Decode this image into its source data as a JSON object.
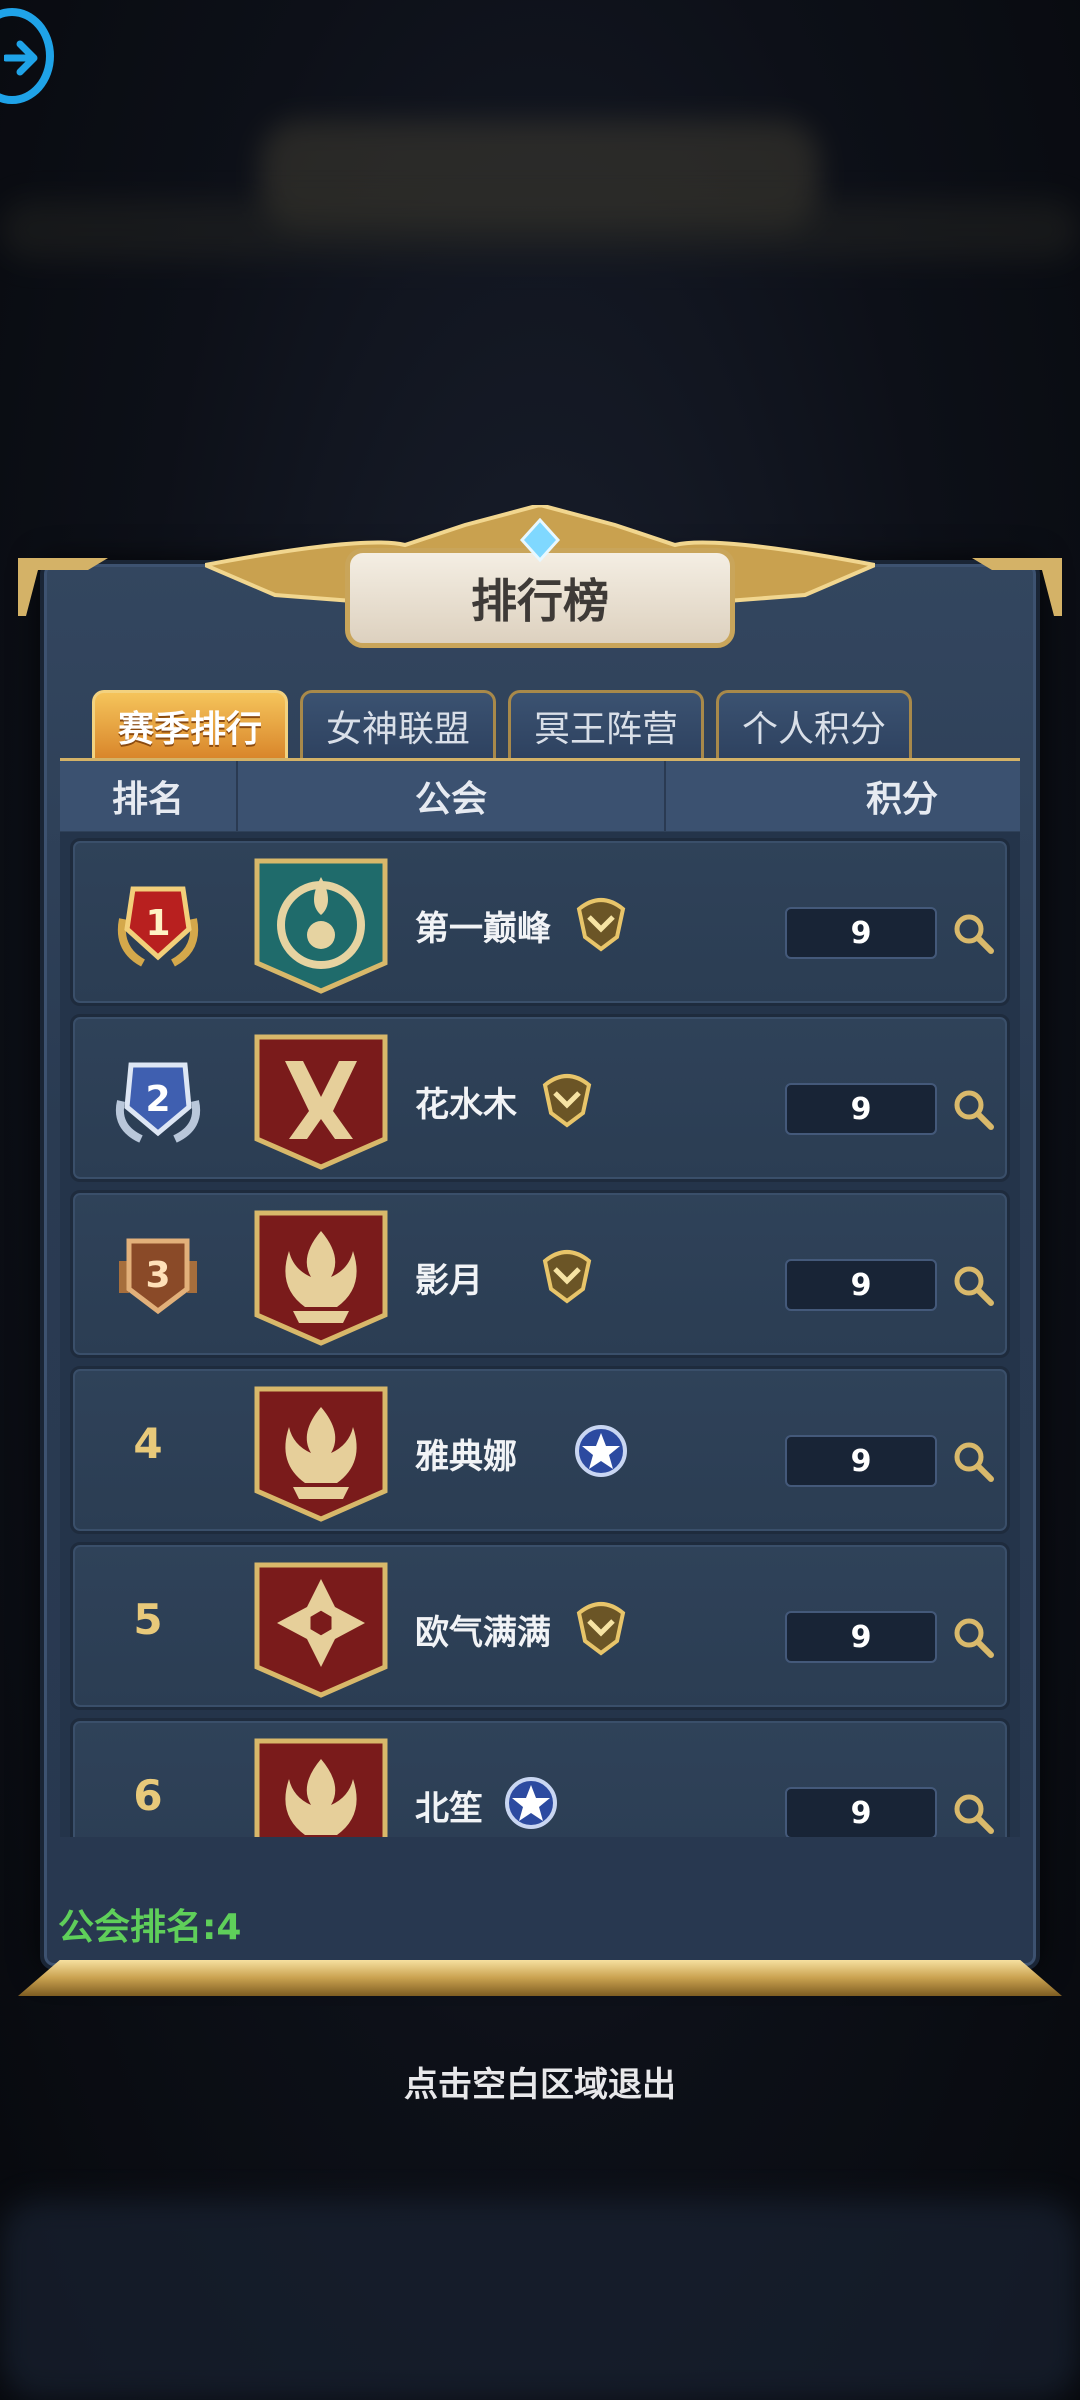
{
  "title": "排行榜",
  "tabs": [
    {
      "label": "赛季排行",
      "active": true
    },
    {
      "label": "女神联盟",
      "active": false
    },
    {
      "label": "冥王阵营",
      "active": false
    },
    {
      "label": "个人积分",
      "active": false
    }
  ],
  "columns": {
    "rank": "排名",
    "guild": "公会",
    "score": "积分"
  },
  "rows": [
    {
      "rank": "1",
      "name": "第一巅峰",
      "score": "9",
      "emblem": "teal-flame-crest",
      "badge": "gold-wing-badge"
    },
    {
      "rank": "2",
      "name": "花水木",
      "score": "9",
      "emblem": "red-rune-crest",
      "badge": "gold-wing-badge"
    },
    {
      "rank": "3",
      "name": "影月",
      "score": "9",
      "emblem": "red-flame-crest",
      "badge": "gold-wing-badge"
    },
    {
      "rank": "4",
      "name": "雅典娜",
      "score": "9",
      "emblem": "red-flame-crest",
      "badge": "blue-star-badge"
    },
    {
      "rank": "5",
      "name": "欧气满满",
      "score": "9",
      "emblem": "red-hex-crest",
      "badge": "gold-wing-badge"
    },
    {
      "rank": "6",
      "name": "北笙",
      "score": "9",
      "emblem": "red-flame-crest",
      "badge": "blue-star-badge"
    }
  ],
  "guild_rank": "公会排名:4",
  "hint": "点击空白区域退出",
  "colors": {
    "gold": "#d4b267",
    "panel": "#2a3b52",
    "tab_active": "#e9a23c",
    "green_text": "#5fcf5a",
    "exit_blue": "#1fa3e8"
  }
}
